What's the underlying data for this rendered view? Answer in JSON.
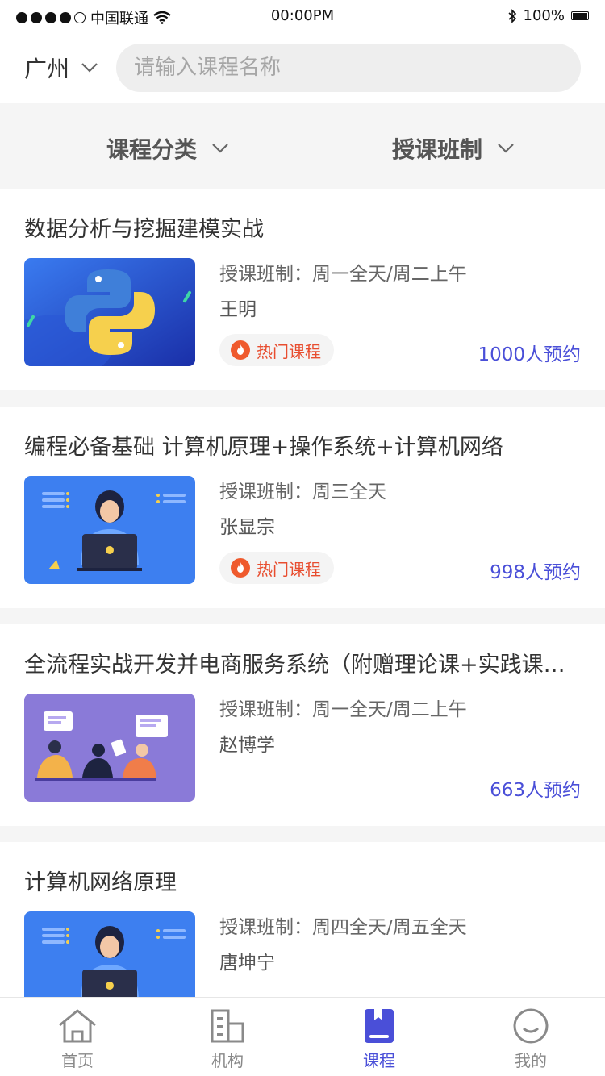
{
  "status": {
    "carrier": "中国联通",
    "time": "00:00PM",
    "battery": "100%"
  },
  "header": {
    "city": "广州",
    "search_placeholder": "请输入课程名称"
  },
  "filters": [
    {
      "label": "课程分类"
    },
    {
      "label": "授课班制"
    }
  ],
  "courses": [
    {
      "title": "数据分析与挖掘建模实战",
      "schedule": "授课班制：周一全天/周二上午",
      "teacher": "王明",
      "badge": "热门课程",
      "bookings": "1000人预约",
      "thumb": "python-thumbnail"
    },
    {
      "title": "编程必备基础  计算机原理+操作系统+计算机网络",
      "schedule": "授课班制：周三全天",
      "teacher": "张显宗",
      "badge": "热门课程",
      "bookings": "998人预约",
      "thumb": "programmer-thumbnail"
    },
    {
      "title": "全流程实战开发并电商服务系统（附赠理论课+实践课…",
      "schedule": "授课班制：周一全天/周二上午",
      "teacher": "赵博学",
      "badge": "",
      "bookings": "663人预约",
      "thumb": "meeting-thumbnail"
    },
    {
      "title": "计算机网络原理",
      "schedule": "授课班制：周四全天/周五全天",
      "teacher": "唐坤宁",
      "badge": "",
      "bookings": "",
      "thumb": "programmer-thumbnail"
    }
  ],
  "tabs": [
    {
      "label": "首页",
      "icon": "home-icon"
    },
    {
      "label": "机构",
      "icon": "building-icon"
    },
    {
      "label": "课程",
      "icon": "book-icon"
    },
    {
      "label": "我的",
      "icon": "profile-icon"
    }
  ],
  "colors": {
    "accent": "#4a4fd8",
    "hot": "#e84d2f"
  }
}
